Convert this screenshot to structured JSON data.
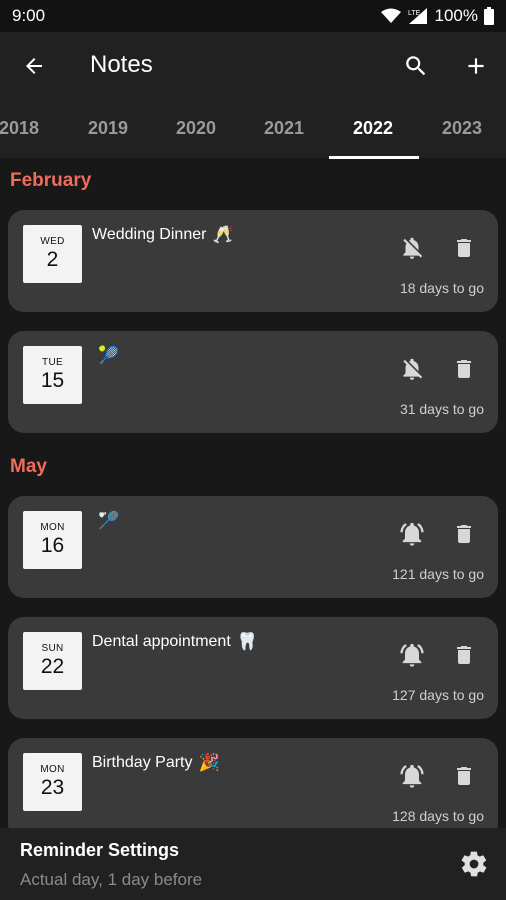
{
  "status_bar": {
    "time": "9:00",
    "battery_text": "100%"
  },
  "app_bar": {
    "title": "Notes"
  },
  "tabs": [
    {
      "label": "2018"
    },
    {
      "label": "2019"
    },
    {
      "label": "2020"
    },
    {
      "label": "2021"
    },
    {
      "label": "2022",
      "active": true
    },
    {
      "label": "2023"
    }
  ],
  "sections": [
    {
      "header": "February",
      "notes": [
        {
          "dow": "WED",
          "day": "2",
          "title": "Wedding Dinner",
          "emoji": "🥂",
          "reminder": "off",
          "days_to_go": "18 days to go"
        },
        {
          "dow": "TUE",
          "day": "15",
          "title": "",
          "emoji": "🎾",
          "reminder": "off",
          "days_to_go": "31 days to go"
        }
      ]
    },
    {
      "header": "May",
      "notes": [
        {
          "dow": "MON",
          "day": "16",
          "title": "",
          "emoji": "🏸",
          "reminder": "on",
          "days_to_go": "121 days to go"
        },
        {
          "dow": "SUN",
          "day": "22",
          "title": "Dental appointment",
          "emoji": "🦷",
          "reminder": "on",
          "days_to_go": "127 days to go"
        },
        {
          "dow": "MON",
          "day": "23",
          "title": "Birthday Party",
          "emoji": "🎉",
          "reminder": "on",
          "days_to_go": "128 days to go"
        }
      ]
    }
  ],
  "reminder_settings": {
    "title": "Reminder Settings",
    "subtitle": "Actual day, 1 day before"
  },
  "colors": {
    "accent": "#ef6c5b",
    "card": "#3a3a3a",
    "background": "#181818",
    "appbar": "#212121"
  }
}
